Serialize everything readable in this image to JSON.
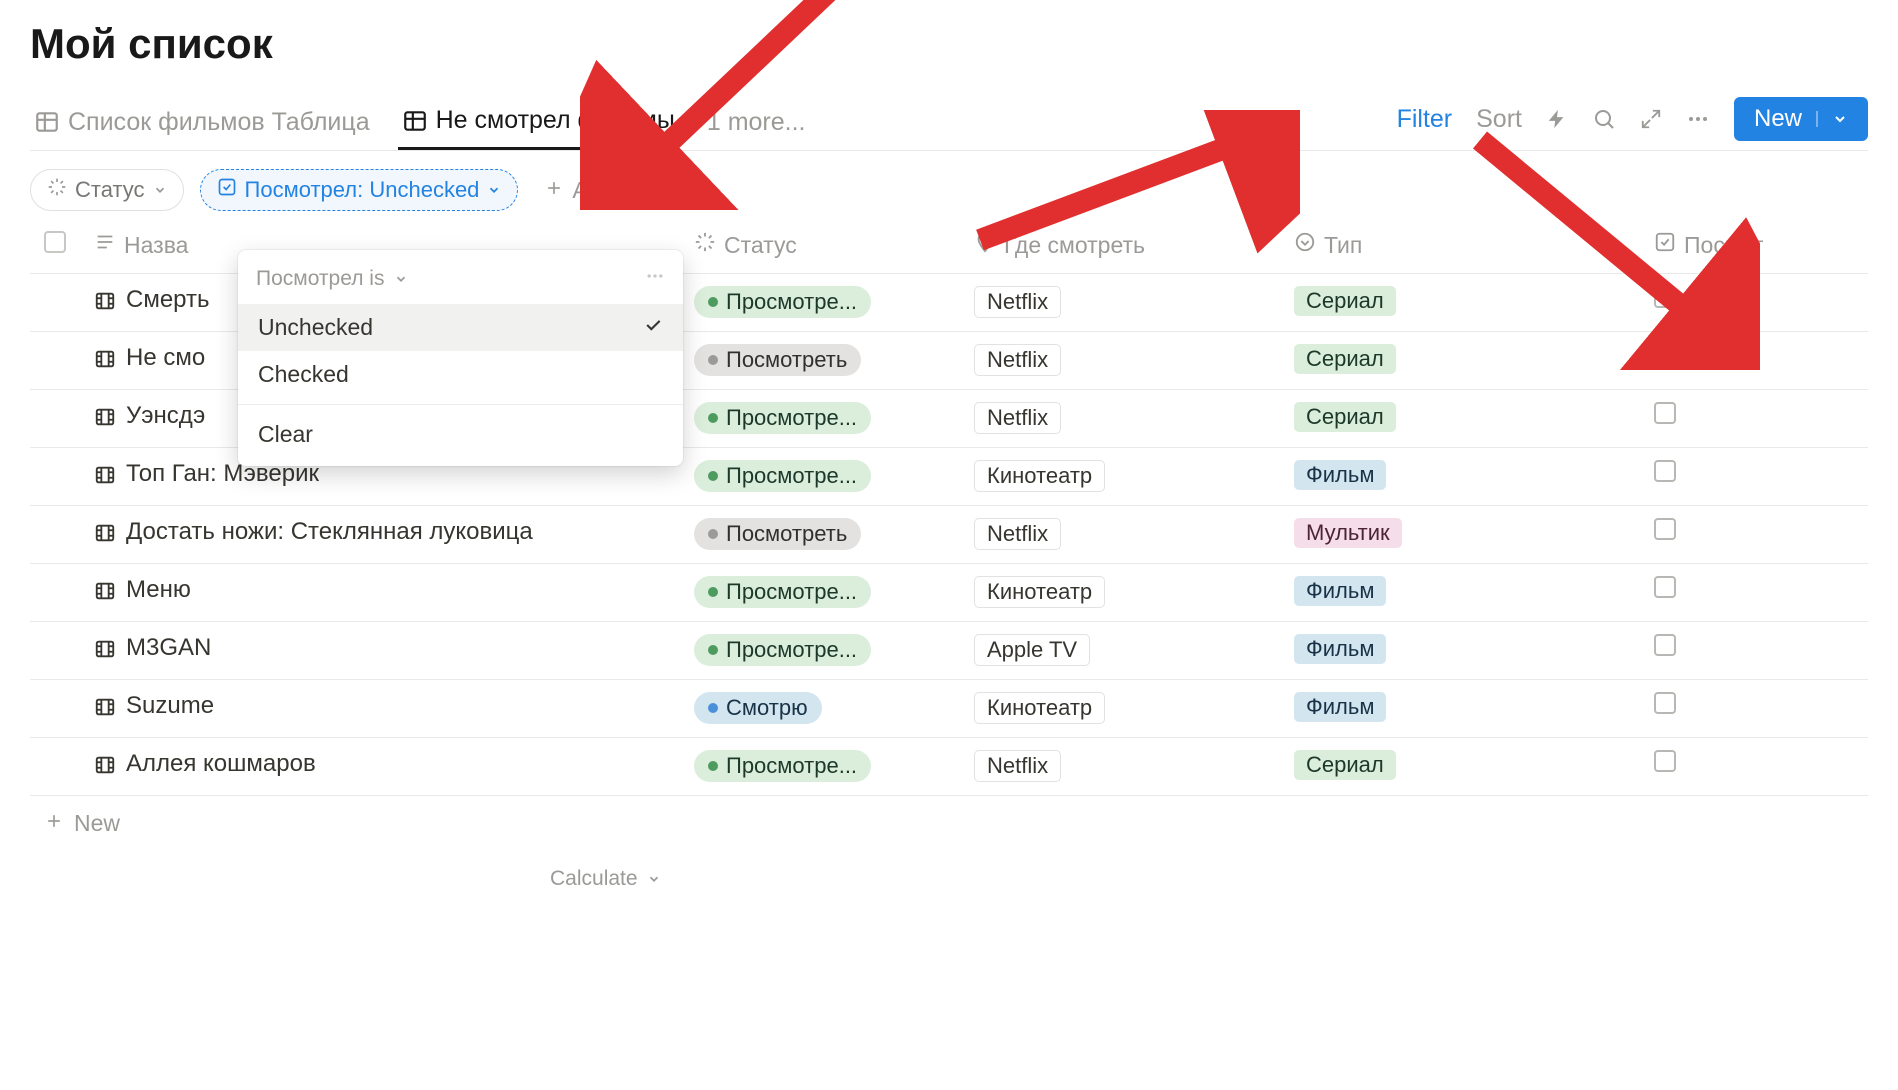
{
  "page_title": "Мой список",
  "tabs": {
    "list": "Список фильмов Таблица",
    "unwatched": "Не смотрел фильмы",
    "more": "1 more..."
  },
  "toolbar": {
    "filter": "Filter",
    "sort": "Sort",
    "new": "New"
  },
  "filters": {
    "status_label": "Статус",
    "watched_label": "Посмотрел: Unchecked",
    "add": "Add filter"
  },
  "dropdown": {
    "header": "Посмотрел is",
    "option_unchecked": "Unchecked",
    "option_checked": "Checked",
    "clear": "Clear"
  },
  "columns": {
    "name": "Назва",
    "status": "Статус",
    "where": "Где смотреть",
    "type": "Тип",
    "watched": "Посмот"
  },
  "rows": [
    {
      "title": "Смерть",
      "status": "Просмотре...",
      "status_color": "green",
      "where": "Netflix",
      "type": "Сериал",
      "type_class": "type-serial"
    },
    {
      "title": "Не смо",
      "status": "Посмотреть",
      "status_color": "gray",
      "where": "Netflix",
      "type": "Сериал",
      "type_class": "type-serial"
    },
    {
      "title": "Уэнсдэ",
      "status": "Просмотре...",
      "status_color": "green",
      "where": "Netflix",
      "type": "Сериал",
      "type_class": "type-serial"
    },
    {
      "title": "Топ Ган: Мэверик",
      "status": "Просмотре...",
      "status_color": "green",
      "where": "Кинотеатр",
      "type": "Фильм",
      "type_class": "type-film"
    },
    {
      "title": "Достать ножи: Стеклянная луковица",
      "status": "Посмотреть",
      "status_color": "gray",
      "where": "Netflix",
      "type": "Мультик",
      "type_class": "type-mult"
    },
    {
      "title": "Меню",
      "status": "Просмотре...",
      "status_color": "green",
      "where": "Кинотеатр",
      "type": "Фильм",
      "type_class": "type-film"
    },
    {
      "title": "M3GAN",
      "status": "Просмотре...",
      "status_color": "green",
      "where": "Apple TV",
      "type": "Фильм",
      "type_class": "type-film"
    },
    {
      "title": "Suzume",
      "status": "Смотрю",
      "status_color": "blue",
      "where": "Кинотеатр",
      "type": "Фильм",
      "type_class": "type-film"
    },
    {
      "title": "Аллея кошмаров",
      "status": "Просмотре...",
      "status_color": "green",
      "where": "Netflix",
      "type": "Сериал",
      "type_class": "type-serial"
    }
  ],
  "footer": {
    "new": "New",
    "calculate": "Calculate"
  }
}
